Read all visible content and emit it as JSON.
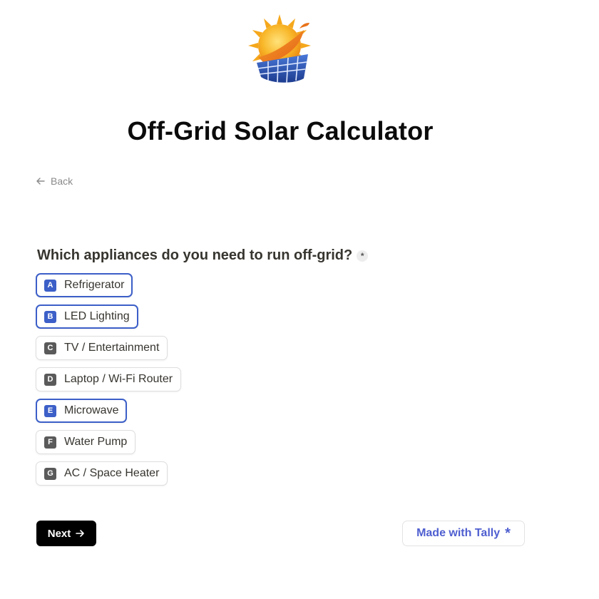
{
  "header": {
    "logo_icon": "sun-solar-panel-logo-icon",
    "title": "Off-Grid Solar Calculator"
  },
  "nav": {
    "back_label": "Back"
  },
  "question": {
    "text": "Which appliances do you need to run off-grid?",
    "required_mark": "*"
  },
  "options": [
    {
      "key": "A",
      "label": "Refrigerator",
      "selected": true
    },
    {
      "key": "B",
      "label": "LED Lighting",
      "selected": true
    },
    {
      "key": "C",
      "label": "TV / Entertainment",
      "selected": false
    },
    {
      "key": "D",
      "label": "Laptop / Wi-Fi Router",
      "selected": false
    },
    {
      "key": "E",
      "label": "Microwave",
      "selected": true
    },
    {
      "key": "F",
      "label": "Water Pump",
      "selected": false
    },
    {
      "key": "G",
      "label": "AC / Space Heater",
      "selected": false
    }
  ],
  "footer": {
    "next_label": "Next",
    "badge_label": "Made with Tally",
    "badge_mark": "*"
  },
  "colors": {
    "accent": "#3c5fc8",
    "tally": "#4f5fd0",
    "button": "#000000"
  }
}
